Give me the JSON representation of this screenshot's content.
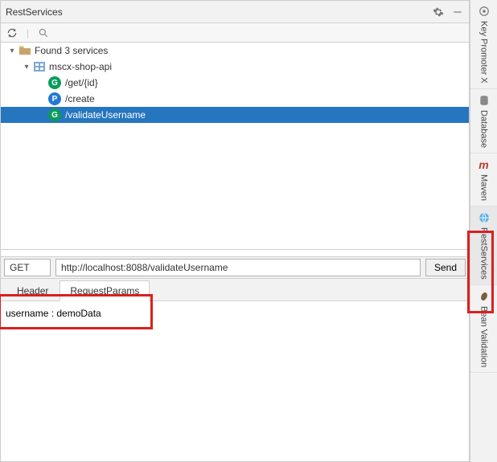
{
  "header": {
    "title": "RestServices"
  },
  "tree": {
    "root_label": "Found 3 services",
    "module_label": "mscx-shop-api",
    "endpoints": [
      {
        "method": "G",
        "path": "/get/{id}"
      },
      {
        "method": "P",
        "path": "/create"
      },
      {
        "method": "G",
        "path": "/validateUsername"
      }
    ]
  },
  "request": {
    "method": "GET",
    "url": "http://localhost:8088/validateUsername",
    "send_label": "Send"
  },
  "tabs": {
    "header": "Header",
    "params": "RequestParams"
  },
  "params_text": "username : demoData",
  "sidebar": {
    "items": [
      {
        "label": "Key Promoter X"
      },
      {
        "label": "Database"
      },
      {
        "label": "Maven"
      },
      {
        "label": "RestServices"
      },
      {
        "label": "Bean Validation"
      }
    ]
  }
}
